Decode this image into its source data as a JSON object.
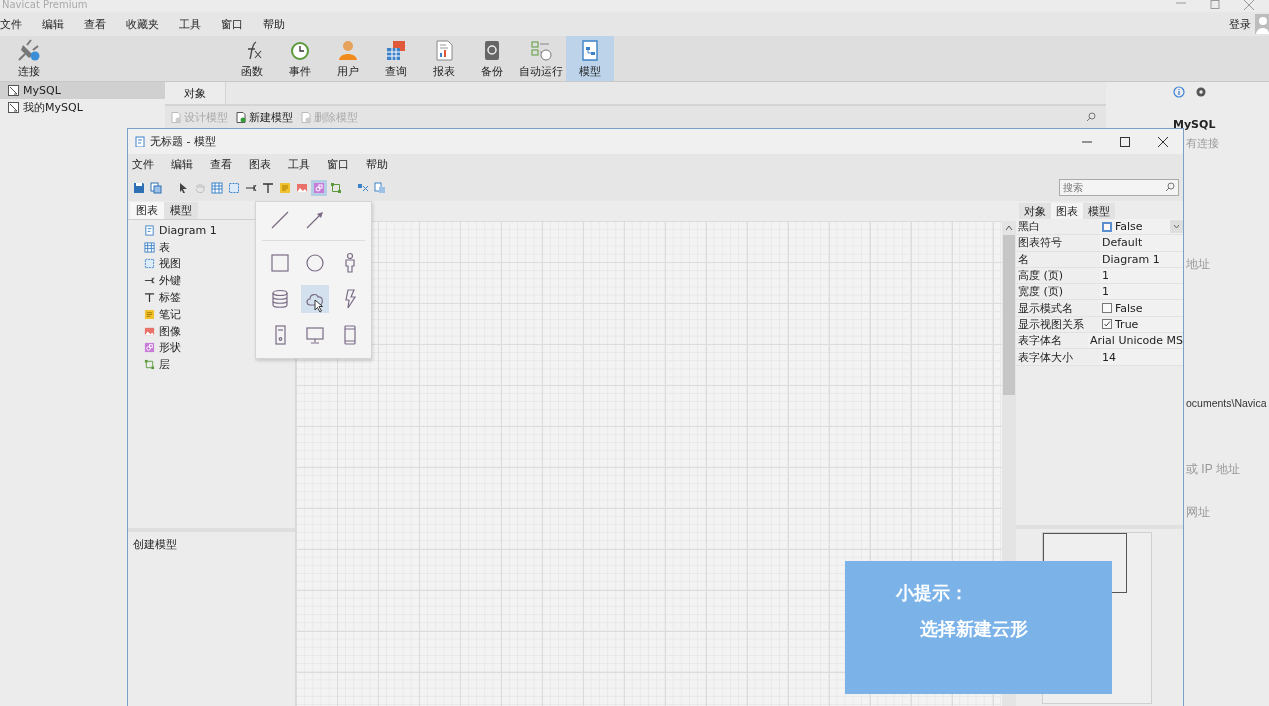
{
  "app": {
    "title": "Navicat Premium",
    "menu": [
      "文件",
      "编辑",
      "查看",
      "收藏夹",
      "工具",
      "窗口",
      "帮助"
    ],
    "login": "登录",
    "toolbar": [
      {
        "label": "连接",
        "kind": "connect",
        "selected": false
      },
      {
        "label": "函数",
        "kind": "function",
        "selected": false
      },
      {
        "label": "事件",
        "kind": "event",
        "selected": false
      },
      {
        "label": "用户",
        "kind": "user",
        "selected": false
      },
      {
        "label": "查询",
        "kind": "query",
        "selected": false
      },
      {
        "label": "报表",
        "kind": "report",
        "selected": false
      },
      {
        "label": "备份",
        "kind": "backup",
        "selected": false
      },
      {
        "label": "自动运行",
        "kind": "automation",
        "selected": false
      },
      {
        "label": "模型",
        "kind": "model",
        "selected": true
      }
    ],
    "sidebar": [
      {
        "label": "MySQL",
        "selected": true
      },
      {
        "label": "我的MySQL",
        "selected": false
      }
    ],
    "object_tab": "对象",
    "object_actions": [
      {
        "label": "设计模型",
        "disabled": true
      },
      {
        "label": "新建模型",
        "disabled": false
      },
      {
        "label": "删除模型",
        "disabled": true
      }
    ],
    "info_panel": {
      "name": "MySQL",
      "status": "有连接",
      "lines": [
        "地址",
        "ocuments\\Navica",
        "或 IP 地址",
        "网址"
      ]
    }
  },
  "model_window": {
    "title": "无标题 - 模型",
    "menu": [
      "文件",
      "编辑",
      "查看",
      "图表",
      "工具",
      "窗口",
      "帮助"
    ],
    "toolbar": [
      {
        "kind": "save",
        "selected": false
      },
      {
        "kind": "copy",
        "selected": false
      },
      {
        "kind": "pointer",
        "selected": false
      },
      {
        "kind": "hand",
        "selected": false
      },
      {
        "kind": "table",
        "selected": false
      },
      {
        "kind": "view",
        "selected": false
      },
      {
        "kind": "foreign_key",
        "selected": false
      },
      {
        "kind": "label",
        "selected": false
      },
      {
        "kind": "note",
        "selected": false
      },
      {
        "kind": "image",
        "selected": false
      },
      {
        "kind": "shape",
        "selected": true
      },
      {
        "kind": "layer",
        "selected": false
      },
      {
        "kind": "align",
        "selected": false
      },
      {
        "kind": "arrange",
        "selected": false
      }
    ],
    "search": {
      "placeholder": "搜索"
    },
    "left_tabs": [
      {
        "label": "图表",
        "selected": true
      },
      {
        "label": "模型",
        "selected": false
      }
    ],
    "tree": [
      {
        "label": "Diagram 1",
        "kind": "diagram"
      },
      {
        "label": "表",
        "kind": "table"
      },
      {
        "label": "视图",
        "kind": "view"
      },
      {
        "label": "外键",
        "kind": "foreign_key"
      },
      {
        "label": "标签",
        "kind": "label"
      },
      {
        "label": "笔记",
        "kind": "note"
      },
      {
        "label": "图像",
        "kind": "image"
      },
      {
        "label": "形状",
        "kind": "shape"
      },
      {
        "label": "层",
        "kind": "layer"
      }
    ],
    "description": "创建模型",
    "shape_menu": {
      "lines": [
        {
          "kind": "line",
          "selected": false
        },
        {
          "kind": "arrow",
          "selected": false
        }
      ],
      "shapes": [
        {
          "kind": "rectangle",
          "selected": false
        },
        {
          "kind": "circle",
          "selected": false
        },
        {
          "kind": "person",
          "selected": false
        },
        {
          "kind": "database",
          "selected": false
        },
        {
          "kind": "cloud",
          "selected": true
        },
        {
          "kind": "lightning",
          "selected": false
        },
        {
          "kind": "server",
          "selected": false
        },
        {
          "kind": "monitor",
          "selected": false
        },
        {
          "kind": "phone",
          "selected": false
        }
      ]
    },
    "right_tabs": [
      {
        "label": "对象",
        "selected": false
      },
      {
        "label": "图表",
        "selected": true
      },
      {
        "label": "模型",
        "selected": false
      }
    ],
    "properties": [
      {
        "name": "黑白",
        "kind": "checkbox",
        "value": "False",
        "checked": false,
        "dropdown": true
      },
      {
        "name": "图表符号",
        "kind": "text",
        "value": "Default"
      },
      {
        "name": "名",
        "kind": "text",
        "value": "Diagram 1"
      },
      {
        "name": "高度 (页)",
        "kind": "text",
        "value": "1"
      },
      {
        "name": "宽度 (页)",
        "kind": "text",
        "value": "1"
      },
      {
        "name": "显示模式名",
        "kind": "checkbox",
        "value": "False",
        "checked": false,
        "dropdown": false
      },
      {
        "name": "显示视图关系",
        "kind": "checkbox",
        "value": "True",
        "checked": true,
        "dropdown": false
      },
      {
        "name": "表字体名",
        "kind": "text",
        "value": "Arial Unicode MS"
      },
      {
        "name": "表字体大小",
        "kind": "text",
        "value": "14"
      }
    ]
  },
  "tip": {
    "title": "小提示：",
    "text": "选择新建云形"
  }
}
